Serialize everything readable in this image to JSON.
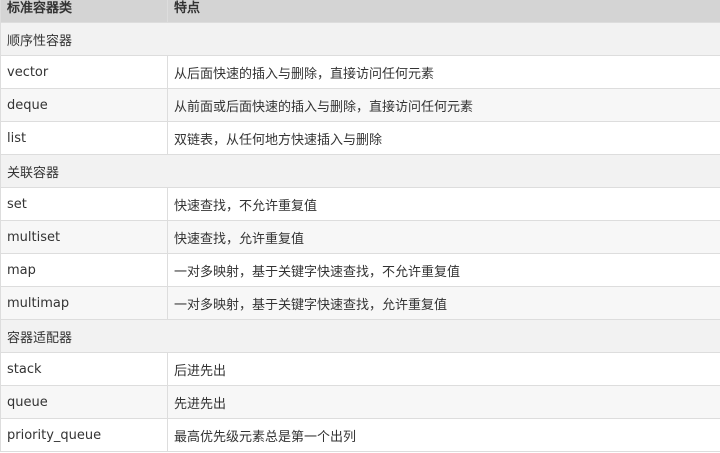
{
  "table": {
    "headers": [
      "标准容器类",
      "特点"
    ],
    "sections": [
      {
        "category": "顺序性容器",
        "rows": [
          {
            "name": "vector",
            "desc": "从后面快速的插入与删除，直接访问任何元素"
          },
          {
            "name": "deque",
            "desc": "从前面或后面快速的插入与删除，直接访问任何元素"
          },
          {
            "name": "list",
            "desc": "双链表，从任何地方快速插入与删除"
          }
        ]
      },
      {
        "category": "关联容器",
        "rows": [
          {
            "name": "set",
            "desc": "快速查找，不允许重复值"
          },
          {
            "name": "multiset",
            "desc": "快速查找，允许重复值"
          },
          {
            "name": "map",
            "desc": "一对多映射，基于关键字快速查找，不允许重复值"
          },
          {
            "name": "multimap",
            "desc": "一对多映射，基于关键字快速查找，允许重复值"
          }
        ]
      },
      {
        "category": "容器适配器",
        "rows": [
          {
            "name": "stack",
            "desc": "后进先出"
          },
          {
            "name": "queue",
            "desc": "先进先出"
          },
          {
            "name": "priority_queue",
            "desc": "最高优先级元素总是第一个出列"
          }
        ]
      }
    ]
  }
}
